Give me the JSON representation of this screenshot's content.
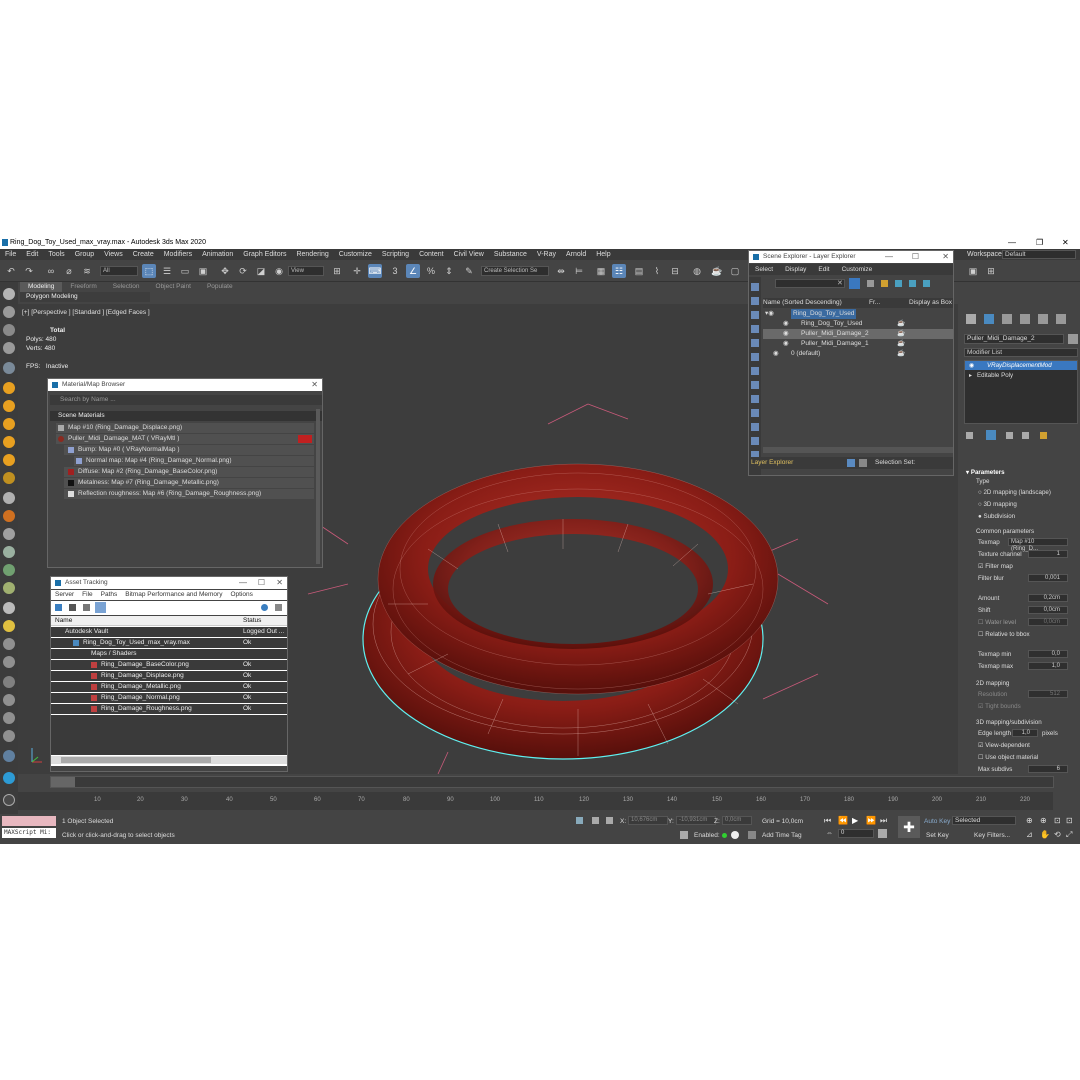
{
  "window": {
    "title": "Ring_Dog_Toy_Used_max_vray.max - Autodesk 3ds Max 2020",
    "min": "—",
    "max": "❐",
    "close": "✕"
  },
  "menu": [
    "File",
    "Edit",
    "Tools",
    "Group",
    "Views",
    "Create",
    "Modifiers",
    "Animation",
    "Graph Editors",
    "Rendering",
    "Customize",
    "Scripting",
    "Content",
    "Civil View",
    "Substance",
    "V-Ray",
    "Arnold",
    "Help"
  ],
  "workspace": {
    "label": "Workspaces:",
    "value": "Default"
  },
  "toolbar": {
    "filter_value": "All",
    "ref_coord_value": "View",
    "create_selection_set": "Create Selection Se"
  },
  "ribbon": {
    "tabs": [
      "Modeling",
      "Freeform",
      "Selection",
      "Object Paint",
      "Populate"
    ],
    "active_tab": "Modeling",
    "subtitle": "Polygon Modeling"
  },
  "viewport": {
    "label": "[+] [Perspective ] [Standard ] [Edged Faces ]",
    "stats_total": "Total",
    "polys_label": "Polys:",
    "polys_value": "480",
    "verts_label": "Verts:",
    "verts_value": "480",
    "fps_label": "FPS:",
    "fps_value": "Inactive"
  },
  "material_browser": {
    "title": "Material/Map Browser",
    "search_placeholder": "Search by Name ...",
    "group": "Scene Materials",
    "items": [
      "Map #10 (Ring_Damage_Displace.png)",
      "Puller_Midi_Damage_MAT  ( VRayMtl )",
      "Bump: Map #0  ( VRayNormalMap )",
      "Normal map: Map #4 (Ring_Damage_Normal.png)",
      "Diffuse: Map #2 (Ring_Damage_BaseColor.png)",
      "Metalness: Map #7 (Ring_Damage_Metallic.png)",
      "Reflection roughness: Map #6 (Ring_Damage_Roughness.png)"
    ]
  },
  "asset_tracking": {
    "title": "Asset Tracking",
    "menu": [
      "Server",
      "File",
      "Paths",
      "Bitmap Performance and Memory",
      "Options"
    ],
    "columns": [
      "Name",
      "Status"
    ],
    "rows": [
      {
        "name": "Autodesk Vault",
        "status": "Logged Out ..."
      },
      {
        "name": "Ring_Dog_Toy_Used_max_vray.max",
        "status": "Ok"
      },
      {
        "name": "Maps / Shaders",
        "status": ""
      },
      {
        "name": "Ring_Damage_BaseColor.png",
        "status": "Ok"
      },
      {
        "name": "Ring_Damage_Displace.png",
        "status": "Ok"
      },
      {
        "name": "Ring_Damage_Metallic.png",
        "status": "Ok"
      },
      {
        "name": "Ring_Damage_Normal.png",
        "status": "Ok"
      },
      {
        "name": "Ring_Damage_Roughness.png",
        "status": "Ok"
      }
    ]
  },
  "scene_explorer": {
    "title": "Scene Explorer - Layer Explorer",
    "menu": [
      "Select",
      "Display",
      "Edit",
      "Customize"
    ],
    "columns": [
      "Name (Sorted Descending)",
      "Fr...",
      "Display as Box"
    ],
    "rows": [
      "Ring_Dog_Toy_Used",
      "Ring_Dog_Toy_Used",
      "Puller_Midi_Damage_2",
      "Puller_Midi_Damage_1",
      "0 (default)"
    ],
    "footer_left": "Layer Explorer",
    "footer_right": "Selection Set:"
  },
  "modify_panel": {
    "object_name": "Puller_Midi_Damage_2",
    "modifier_list": "Modifier List",
    "stack": [
      "VRayDisplacementMod",
      "Editable Poly"
    ],
    "parameters_title": "Parameters",
    "type_label": "Type",
    "type_options": [
      "2D mapping (landscape)",
      "3D mapping",
      "Subdivision"
    ],
    "common_params": "Common parameters",
    "texmap_label": "Texmap",
    "texmap_value": "Map #10 (Ring_D...",
    "texture_channel_label": "Texture channel",
    "texture_channel_value": "1",
    "filter_map": "Filter map",
    "filter_blur_label": "Filter blur",
    "filter_blur_value": "0,001",
    "amount_label": "Amount",
    "amount_value": "0,2cm",
    "shift_label": "Shift",
    "shift_value": "0,0cm",
    "water_level_label": "Water level",
    "water_level_value": "0,0cm",
    "relative_bbox": "Relative to bbox",
    "texmap_min_label": "Texmap min",
    "texmap_min_value": "0,0",
    "texmap_max_label": "Texmap max",
    "texmap_max_value": "1,0",
    "mapping2d": "2D mapping",
    "resolution_label": "Resolution",
    "resolution_value": "512",
    "tight_bounds": "Tight bounds",
    "mapping3d": "3D mapping/subdivision",
    "edge_length_label": "Edge length",
    "edge_length_value": "1,0",
    "edge_length_unit": "pixels",
    "view_dependent": "View-dependent",
    "use_object_material": "Use object material",
    "max_subdivs_label": "Max subdivs",
    "max_subdivs_value": "6"
  },
  "timeline": {
    "frame": "0 / 225",
    "ticks": [
      "10",
      "20",
      "30",
      "40",
      "50",
      "60",
      "70",
      "80",
      "90",
      "100",
      "110",
      "120",
      "130",
      "140",
      "150",
      "160",
      "170",
      "180",
      "190",
      "200",
      "210",
      "220"
    ]
  },
  "status": {
    "maxscript": "MAXScript Mi:",
    "selected": "1 Object Selected",
    "prompt": "Click or click-and-drag to select objects",
    "x_label": "X:",
    "x_value": "10,676cm",
    "y_label": "Y:",
    "y_value": "-10,931cm",
    "z_label": "Z:",
    "z_value": "0,0cm",
    "grid": "Grid = 10,0cm",
    "enabled_label": "Enabled:",
    "add_time_tag": "Add Time Tag",
    "auto_key": "Auto Key",
    "set_key": "Set Key",
    "selected_dropdown": "Selected",
    "key_filters": "Key Filters...",
    "frame_value": "0"
  }
}
